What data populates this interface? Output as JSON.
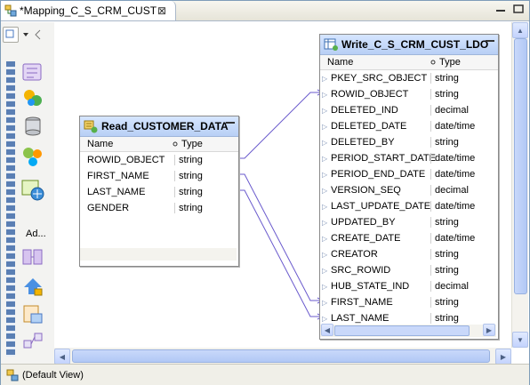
{
  "editor_tab": {
    "title": "*Mapping_C_S_CRM_CUST",
    "close_glyph": "⊠"
  },
  "palette": {
    "selected_label": "Ad..."
  },
  "source": {
    "title": "Read_CUSTOMER_DATA",
    "col_name": "Name",
    "col_type": "Type",
    "rows": [
      {
        "name": "ROWID_OBJECT",
        "type": "string"
      },
      {
        "name": "FIRST_NAME",
        "type": "string"
      },
      {
        "name": "LAST_NAME",
        "type": "string"
      },
      {
        "name": "GENDER",
        "type": "string"
      }
    ]
  },
  "target": {
    "title": "Write_C_S_CRM_CUST_LDO",
    "col_name": "Name",
    "col_type": "Type",
    "rows": [
      {
        "name": "PKEY_SRC_OBJECT",
        "type": "string"
      },
      {
        "name": "ROWID_OBJECT",
        "type": "string"
      },
      {
        "name": "DELETED_IND",
        "type": "decimal"
      },
      {
        "name": "DELETED_DATE",
        "type": "date/time"
      },
      {
        "name": "DELETED_BY",
        "type": "string"
      },
      {
        "name": "PERIOD_START_DATE",
        "type": "date/time"
      },
      {
        "name": "PERIOD_END_DATE",
        "type": "date/time"
      },
      {
        "name": "VERSION_SEQ",
        "type": "decimal"
      },
      {
        "name": "LAST_UPDATE_DATE",
        "type": "date/time"
      },
      {
        "name": "UPDATED_BY",
        "type": "string"
      },
      {
        "name": "CREATE_DATE",
        "type": "date/time"
      },
      {
        "name": "CREATOR",
        "type": "string"
      },
      {
        "name": "SRC_ROWID",
        "type": "string"
      },
      {
        "name": "HUB_STATE_IND",
        "type": "decimal"
      },
      {
        "name": "FIRST_NAME",
        "type": "string"
      },
      {
        "name": "LAST_NAME",
        "type": "string"
      }
    ]
  },
  "links": [
    {
      "from": "ROWID_OBJECT",
      "to": "ROWID_OBJECT"
    },
    {
      "from": "FIRST_NAME",
      "to": "FIRST_NAME"
    },
    {
      "from": "LAST_NAME",
      "to": "LAST_NAME"
    }
  ],
  "status_bar": {
    "view_label": "(Default View)"
  },
  "colors": {
    "link": "#6a5acd",
    "header": "#c7dbf9",
    "palette_strip": "#5a7fb4"
  }
}
